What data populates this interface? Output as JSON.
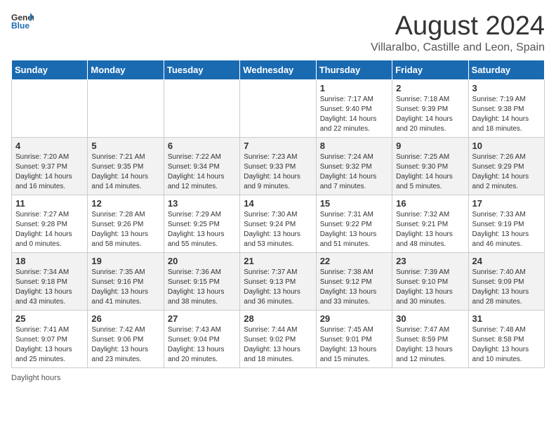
{
  "header": {
    "logo_general": "General",
    "logo_blue": "Blue",
    "month_title": "August 2024",
    "location": "Villaralbo, Castille and Leon, Spain"
  },
  "days_of_week": [
    "Sunday",
    "Monday",
    "Tuesday",
    "Wednesday",
    "Thursday",
    "Friday",
    "Saturday"
  ],
  "weeks": [
    [
      {
        "day": "",
        "info": ""
      },
      {
        "day": "",
        "info": ""
      },
      {
        "day": "",
        "info": ""
      },
      {
        "day": "",
        "info": ""
      },
      {
        "day": "1",
        "info": "Sunrise: 7:17 AM\nSunset: 9:40 PM\nDaylight: 14 hours\nand 22 minutes."
      },
      {
        "day": "2",
        "info": "Sunrise: 7:18 AM\nSunset: 9:39 PM\nDaylight: 14 hours\nand 20 minutes."
      },
      {
        "day": "3",
        "info": "Sunrise: 7:19 AM\nSunset: 9:38 PM\nDaylight: 14 hours\nand 18 minutes."
      }
    ],
    [
      {
        "day": "4",
        "info": "Sunrise: 7:20 AM\nSunset: 9:37 PM\nDaylight: 14 hours\nand 16 minutes."
      },
      {
        "day": "5",
        "info": "Sunrise: 7:21 AM\nSunset: 9:35 PM\nDaylight: 14 hours\nand 14 minutes."
      },
      {
        "day": "6",
        "info": "Sunrise: 7:22 AM\nSunset: 9:34 PM\nDaylight: 14 hours\nand 12 minutes."
      },
      {
        "day": "7",
        "info": "Sunrise: 7:23 AM\nSunset: 9:33 PM\nDaylight: 14 hours\nand 9 minutes."
      },
      {
        "day": "8",
        "info": "Sunrise: 7:24 AM\nSunset: 9:32 PM\nDaylight: 14 hours\nand 7 minutes."
      },
      {
        "day": "9",
        "info": "Sunrise: 7:25 AM\nSunset: 9:30 PM\nDaylight: 14 hours\nand 5 minutes."
      },
      {
        "day": "10",
        "info": "Sunrise: 7:26 AM\nSunset: 9:29 PM\nDaylight: 14 hours\nand 2 minutes."
      }
    ],
    [
      {
        "day": "11",
        "info": "Sunrise: 7:27 AM\nSunset: 9:28 PM\nDaylight: 14 hours\nand 0 minutes."
      },
      {
        "day": "12",
        "info": "Sunrise: 7:28 AM\nSunset: 9:26 PM\nDaylight: 13 hours\nand 58 minutes."
      },
      {
        "day": "13",
        "info": "Sunrise: 7:29 AM\nSunset: 9:25 PM\nDaylight: 13 hours\nand 55 minutes."
      },
      {
        "day": "14",
        "info": "Sunrise: 7:30 AM\nSunset: 9:24 PM\nDaylight: 13 hours\nand 53 minutes."
      },
      {
        "day": "15",
        "info": "Sunrise: 7:31 AM\nSunset: 9:22 PM\nDaylight: 13 hours\nand 51 minutes."
      },
      {
        "day": "16",
        "info": "Sunrise: 7:32 AM\nSunset: 9:21 PM\nDaylight: 13 hours\nand 48 minutes."
      },
      {
        "day": "17",
        "info": "Sunrise: 7:33 AM\nSunset: 9:19 PM\nDaylight: 13 hours\nand 46 minutes."
      }
    ],
    [
      {
        "day": "18",
        "info": "Sunrise: 7:34 AM\nSunset: 9:18 PM\nDaylight: 13 hours\nand 43 minutes."
      },
      {
        "day": "19",
        "info": "Sunrise: 7:35 AM\nSunset: 9:16 PM\nDaylight: 13 hours\nand 41 minutes."
      },
      {
        "day": "20",
        "info": "Sunrise: 7:36 AM\nSunset: 9:15 PM\nDaylight: 13 hours\nand 38 minutes."
      },
      {
        "day": "21",
        "info": "Sunrise: 7:37 AM\nSunset: 9:13 PM\nDaylight: 13 hours\nand 36 minutes."
      },
      {
        "day": "22",
        "info": "Sunrise: 7:38 AM\nSunset: 9:12 PM\nDaylight: 13 hours\nand 33 minutes."
      },
      {
        "day": "23",
        "info": "Sunrise: 7:39 AM\nSunset: 9:10 PM\nDaylight: 13 hours\nand 30 minutes."
      },
      {
        "day": "24",
        "info": "Sunrise: 7:40 AM\nSunset: 9:09 PM\nDaylight: 13 hours\nand 28 minutes."
      }
    ],
    [
      {
        "day": "25",
        "info": "Sunrise: 7:41 AM\nSunset: 9:07 PM\nDaylight: 13 hours\nand 25 minutes."
      },
      {
        "day": "26",
        "info": "Sunrise: 7:42 AM\nSunset: 9:06 PM\nDaylight: 13 hours\nand 23 minutes."
      },
      {
        "day": "27",
        "info": "Sunrise: 7:43 AM\nSunset: 9:04 PM\nDaylight: 13 hours\nand 20 minutes."
      },
      {
        "day": "28",
        "info": "Sunrise: 7:44 AM\nSunset: 9:02 PM\nDaylight: 13 hours\nand 18 minutes."
      },
      {
        "day": "29",
        "info": "Sunrise: 7:45 AM\nSunset: 9:01 PM\nDaylight: 13 hours\nand 15 minutes."
      },
      {
        "day": "30",
        "info": "Sunrise: 7:47 AM\nSunset: 8:59 PM\nDaylight: 13 hours\nand 12 minutes."
      },
      {
        "day": "31",
        "info": "Sunrise: 7:48 AM\nSunset: 8:58 PM\nDaylight: 13 hours\nand 10 minutes."
      }
    ]
  ],
  "footer": {
    "daylight_label": "Daylight hours"
  }
}
